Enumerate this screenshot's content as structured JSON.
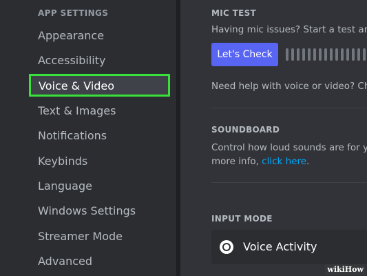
{
  "sidebar": {
    "heading": "APP SETTINGS",
    "items": [
      {
        "label": "Appearance"
      },
      {
        "label": "Accessibility"
      },
      {
        "label": "Voice & Video",
        "selected": true
      },
      {
        "label": "Text & Images"
      },
      {
        "label": "Notifications"
      },
      {
        "label": "Keybinds"
      },
      {
        "label": "Language"
      },
      {
        "label": "Windows Settings"
      },
      {
        "label": "Streamer Mode"
      },
      {
        "label": "Advanced"
      }
    ]
  },
  "main": {
    "mic_test": {
      "title": "MIC TEST",
      "description": "Having mic issues? Start a test and",
      "button_label": "Let's Check",
      "help_text": "Need help with voice or video? Chec"
    },
    "soundboard": {
      "title": "SOUNDBOARD",
      "line1": "Control how loud sounds are for you",
      "line2_prefix": "more info, ",
      "link_text": "click here",
      "line2_suffix": "."
    },
    "input_mode": {
      "title": "INPUT MODE",
      "option_label": "Voice Activity",
      "selected": true
    }
  },
  "watermark": "wikiHow",
  "colors": {
    "accent": "#5865f2",
    "highlight": "#39e23a",
    "link": "#00a8fc"
  }
}
